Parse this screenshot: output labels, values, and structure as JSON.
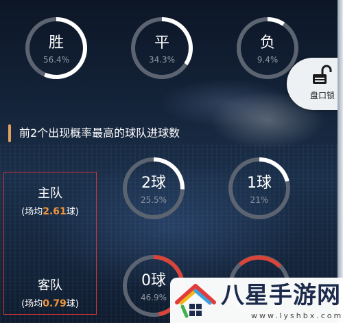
{
  "outcomes": [
    {
      "label": "胜",
      "percent_text": "56.4%",
      "fraction": 0.564
    },
    {
      "label": "平",
      "percent_text": "34.3%",
      "fraction": 0.343
    },
    {
      "label": "负",
      "percent_text": "9.4%",
      "fraction": 0.094
    }
  ],
  "lock_button": {
    "label": "盘口锁",
    "icon": "unlocked-padlock-icon"
  },
  "section": {
    "title": "前2个出现概率最高的球队进球数"
  },
  "home": {
    "team_label": "主队",
    "avg_prefix": "(场均",
    "avg_value": "2.61",
    "avg_suffix": "球)",
    "goals": [
      {
        "label": "2球",
        "percent_text": "25.5%",
        "fraction": 0.255
      },
      {
        "label": "1球",
        "percent_text": "21%",
        "fraction": 0.21
      }
    ]
  },
  "away": {
    "team_label": "客队",
    "avg_prefix": "(场均",
    "avg_value": "0.79",
    "avg_suffix": "球)",
    "goals": [
      {
        "label": "0球",
        "percent_text": "46.9%",
        "fraction": 0.469
      }
    ]
  },
  "watermark": {
    "title": "八星手游网",
    "url": "www.lyshbx.com"
  },
  "colors": {
    "ring_track": "#5b6470",
    "ring_fill": "#ffffff",
    "ring_fill_away": "#d9453a",
    "accent_orange": "#f0953a",
    "box_border": "#c8363b"
  }
}
